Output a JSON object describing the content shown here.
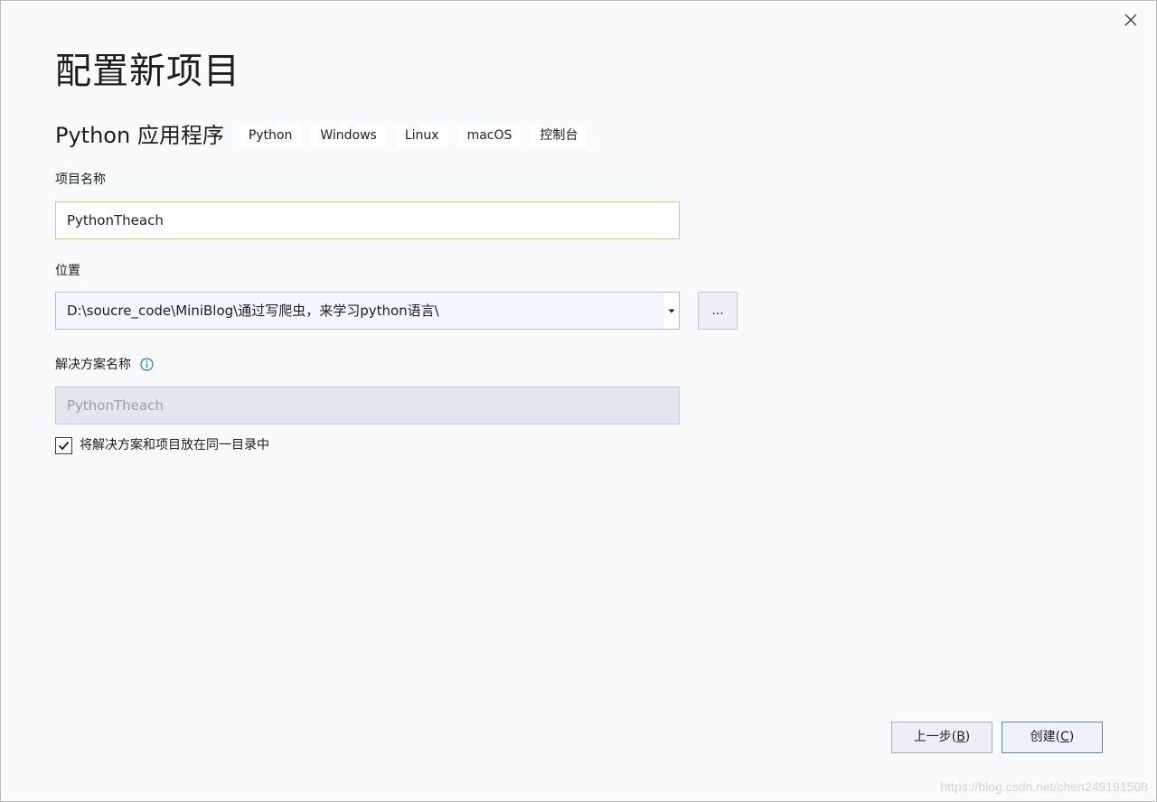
{
  "dialog": {
    "title": "配置新项目",
    "subtitle": "Python 应用程序",
    "tags": [
      "Python",
      "Windows",
      "Linux",
      "macOS",
      "控制台"
    ]
  },
  "project_name": {
    "label": "项目名称",
    "value": "PythonTheach"
  },
  "location": {
    "label": "位置",
    "value": "D:\\soucre_code\\MiniBlog\\通过写爬虫，来学习python语言\\",
    "browse_label": "..."
  },
  "solution_name": {
    "label": "解决方案名称",
    "value": "PythonTheach"
  },
  "same_dir": {
    "label": "将解决方案和项目放在同一目录中",
    "checked": true
  },
  "buttons": {
    "back_text": "上一步(",
    "back_key": "B",
    "back_close": ")",
    "create_text": "创建(",
    "create_key": "C",
    "create_close": ")"
  },
  "watermark": "https://blog.csdn.net/chen249191508",
  "icons": {
    "close": "close-icon",
    "dropdown": "caret-down-icon",
    "info": "info-icon",
    "check": "check-icon"
  },
  "colors": {
    "focus_border": "#e8c469",
    "primary_border": "#5a86c8",
    "info_blue": "#1f7bc1"
  }
}
